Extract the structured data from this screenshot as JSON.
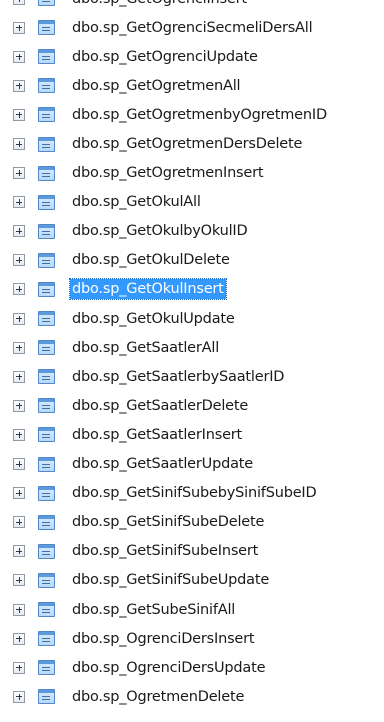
{
  "tree": {
    "selected_index": 11,
    "items": [
      {
        "label": "dbo.sp_GetOgrenciInsert"
      },
      {
        "label": "dbo.sp_GetOgrenciSecmeliDersAll"
      },
      {
        "label": "dbo.sp_GetOgrenciUpdate"
      },
      {
        "label": "dbo.sp_GetOgretmenAll"
      },
      {
        "label": "dbo.sp_GetOgretmenbyOgretmenID"
      },
      {
        "label": "dbo.sp_GetOgretmenDersDelete"
      },
      {
        "label": "dbo.sp_GetOgretmenInsert"
      },
      {
        "label": "dbo.sp_GetOkulAll"
      },
      {
        "label": "dbo.sp_GetOkulbyOkulID"
      },
      {
        "label": "dbo.sp_GetOkulDelete"
      },
      {
        "label": "dbo.sp_GetOkulInsert"
      },
      {
        "label": "dbo.sp_GetOkulUpdate"
      },
      {
        "label": "dbo.sp_GetSaatlerAll"
      },
      {
        "label": "dbo.sp_GetSaatlerbySaatlerID"
      },
      {
        "label": "dbo.sp_GetSaatlerDelete"
      },
      {
        "label": "dbo.sp_GetSaatlerInsert"
      },
      {
        "label": "dbo.sp_GetSaatlerUpdate"
      },
      {
        "label": "dbo.sp_GetSinifSubebySinifSubeID"
      },
      {
        "label": "dbo.sp_GetSinifSubeDelete"
      },
      {
        "label": "dbo.sp_GetSinifSubeInsert"
      },
      {
        "label": "dbo.sp_GetSinifSubeUpdate"
      },
      {
        "label": "dbo.sp_GetSubeSinifAll"
      },
      {
        "label": "dbo.sp_OgrenciDersInsert"
      },
      {
        "label": "dbo.sp_OgrenciDersUpdate"
      },
      {
        "label": "dbo.sp_OgretmenDelete"
      }
    ],
    "icon": "stored-procedure-icon",
    "expander_icon": "expand-plus-icon",
    "colors": {
      "selection": "#3399ff",
      "text": "#1a1a1a"
    }
  }
}
